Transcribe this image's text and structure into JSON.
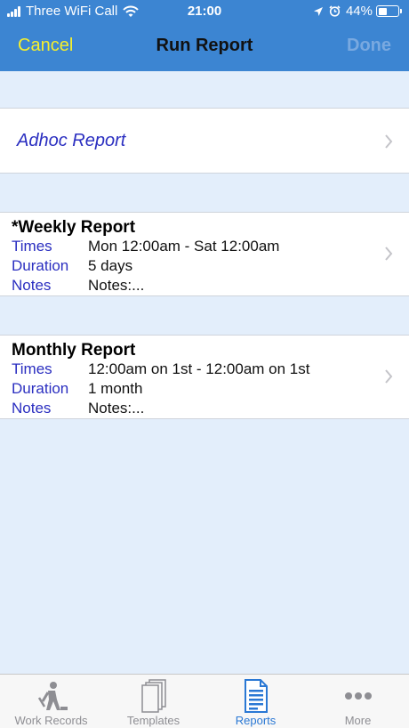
{
  "status_bar": {
    "carrier": "Three WiFi Call",
    "time": "21:00",
    "battery": "44%",
    "battery_level": 0.44
  },
  "nav": {
    "cancel_label": "Cancel",
    "title": "Run Report",
    "done_label": "Done"
  },
  "adhoc": {
    "label": "Adhoc Report"
  },
  "reports": [
    {
      "name": "*Weekly Report",
      "times_label": "Times",
      "times": "Mon 12:00am - Sat 12:00am",
      "duration_label": "Duration",
      "duration": "5 days",
      "notes_label": "Notes",
      "notes": "Notes:..."
    },
    {
      "name": "Monthly Report",
      "times_label": "Times",
      "times": "12:00am on 1st - 12:00am on 1st",
      "duration_label": "Duration",
      "duration": "1 month",
      "notes_label": "Notes",
      "notes": "Notes:..."
    }
  ],
  "tabs": [
    {
      "label": "Work Records",
      "icon": "worker-icon"
    },
    {
      "label": "Templates",
      "icon": "templates-icon"
    },
    {
      "label": "Reports",
      "icon": "report-icon",
      "active": true
    },
    {
      "label": "More",
      "icon": "more-icon"
    }
  ],
  "colors": {
    "nav_bg": "#3c85d2",
    "cancel": "#f6ef2c",
    "label_blue": "#2a2ec0",
    "tab_active": "#2a78d4",
    "background": "#e3eefb"
  }
}
